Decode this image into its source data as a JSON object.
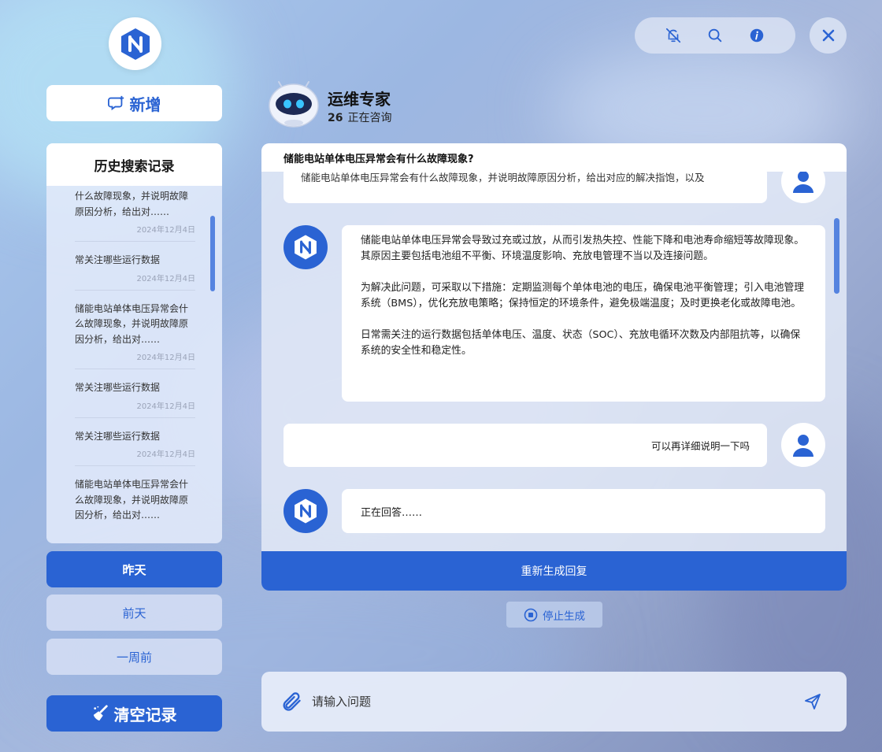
{
  "brand": {
    "logo": "hexagon-s-logo"
  },
  "sidebar": {
    "new_label": "新增",
    "history_title": "历史搜索记录",
    "history_items": [
      {
        "text": "什么故障现象，并说明故障原因分析，给出对……",
        "date": "2024年12月4日"
      },
      {
        "text": "常关注哪些运行数据",
        "date": "2024年12月4日"
      },
      {
        "text": "储能电站单体电压异常会什么故障现象，并说明故障原因分析，给出对……",
        "date": "2024年12月4日"
      },
      {
        "text": "常关注哪些运行数据",
        "date": "2024年12月4日"
      },
      {
        "text": "常关注哪些运行数据",
        "date": "2024年12月4日"
      },
      {
        "text": "储能电站单体电压异常会什么故障现象，并说明故障原因分析，给出对……",
        "date": ""
      }
    ],
    "filters": {
      "yesterday": "昨天",
      "day_before": "前天",
      "week_ago": "一周前"
    },
    "clear_label": "清空记录"
  },
  "toolbar": {
    "icons": [
      "bell-off-icon",
      "search-icon",
      "info-icon",
      "close-icon"
    ]
  },
  "agent": {
    "name": "运维专家",
    "count": "26",
    "status": "正在咨询"
  },
  "chat": {
    "title": "储能电站单体电压异常会有什么故障现象?",
    "messages": {
      "user1": "储能电站单体电压异常会有什么故障现象，并说明故障原因分析，给出对应的解决指饱，以及",
      "bot1_p1": "储能电站单体电压异常会导致过充或过放，从而引发热失控、性能下降和电池寿命缩短等故障现象。其原因主要包括电池组不平衡、环境温度影响、充放电管理不当以及连接问题。",
      "bot1_p2": "为解决此问题，可采取以下措施：定期监测每个单体电池的电压，确保电池平衡管理；引入电池管理系统（BMS），优化充放电策略；保持恒定的环境条件，避免极端温度；及时更换老化或故障电池。",
      "bot1_p3": "日常需关注的运行数据包括单体电压、温度、状态（SOC）、充放电循环次数及内部阻抗等，以确保系统的安全性和稳定性。",
      "user2": "可以再详细说明一下吗",
      "bot2": "正在回答……"
    },
    "regenerate": "重新生成回复",
    "stop": "停止生成"
  },
  "input": {
    "placeholder": "请输入问题"
  },
  "colors": {
    "primary": "#2a63d3",
    "panel": "#e1e8f6"
  }
}
